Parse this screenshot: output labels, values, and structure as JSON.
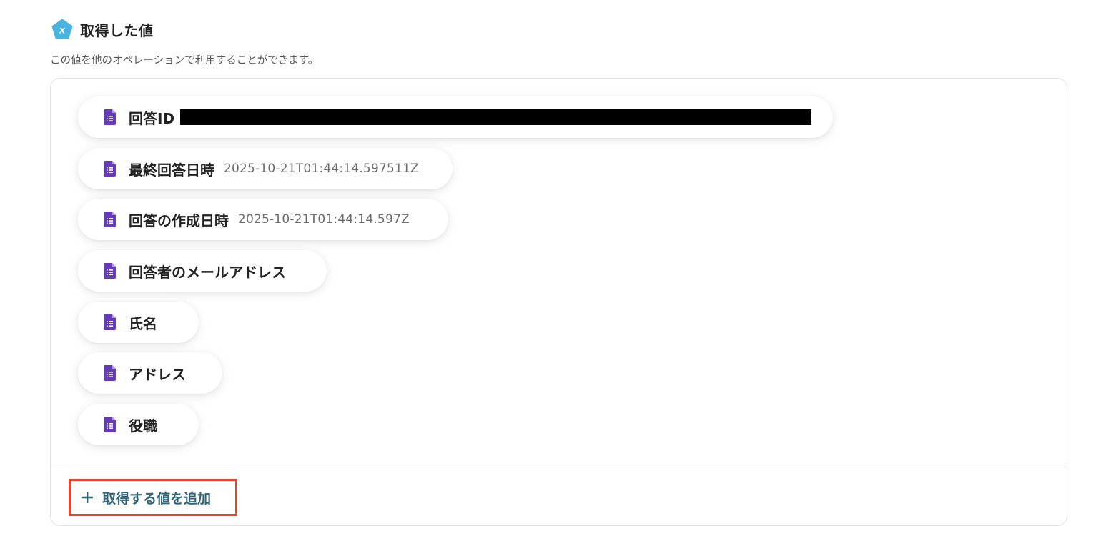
{
  "header": {
    "icon": "x-pentagon-icon",
    "icon_letter": "x",
    "icon_color": "#4ab3e0",
    "title": "取得した値"
  },
  "description": "この値を他のオペレーションで利用することができます。",
  "fields": [
    {
      "label": "回答ID",
      "value": "",
      "redacted": true
    },
    {
      "label": "最終回答日時",
      "value": "2025-10-21T01:44:14.597511Z"
    },
    {
      "label": "回答の作成日時",
      "value": "2025-10-21T01:44:14.597Z"
    },
    {
      "label": "回答者のメールアドレス",
      "value": ""
    },
    {
      "label": "氏名",
      "value": ""
    },
    {
      "label": "アドレス",
      "value": ""
    },
    {
      "label": "役職",
      "value": ""
    }
  ],
  "field_icon": "google-forms-icon",
  "field_icon_color": "#673ab7",
  "add_button": {
    "icon": "plus-icon",
    "label": "取得する値を追加",
    "color": "#2f6577",
    "highlight_color": "#e4452f"
  }
}
